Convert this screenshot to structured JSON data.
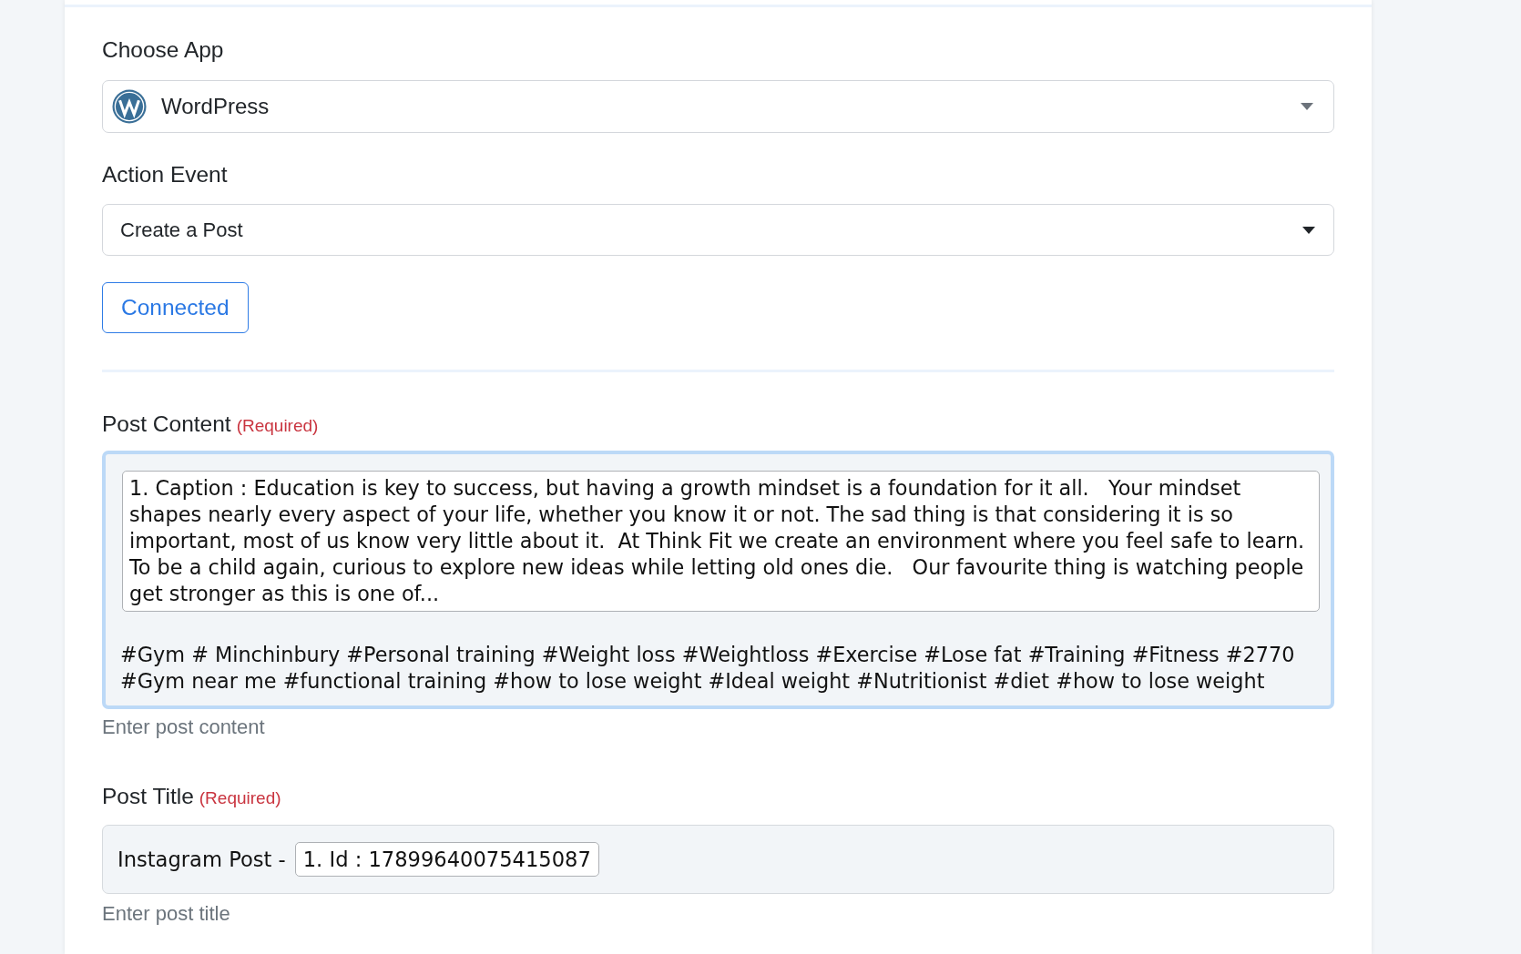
{
  "choose_app": {
    "label": "Choose App",
    "value": "WordPress"
  },
  "action_event": {
    "label": "Action Event",
    "value": "Create a Post"
  },
  "connection_button": {
    "label": "Connected"
  },
  "post_content": {
    "label": "Post Content",
    "required_note": "(Required)",
    "focused": true,
    "parts": [
      {
        "kind": "token",
        "text": "1. Caption : Education is key to success, but having a growth mindset is a foundation for it all.   Your mindset shapes nearly every aspect of your life, whether you know it or not. The sad thing is that considering it is so important, most of us know very little about it.  At Think Fit we create an environment where you feel safe to learn. To be a child again, curious to explore new ideas while letting old ones die.   Our favourite thing is watching people get stronger as this is one of..."
      },
      {
        "kind": "text",
        "text": "#Gym # Minchinbury #Personal training #Weight loss #Weightloss #Exercise #Lose fat #Training #Fitness #2770 #Gym near me #functional training #how to lose weight #Ideal weight #Nutritionist #diet #how to lose weight"
      }
    ],
    "hint": "Enter post content"
  },
  "post_title": {
    "label": "Post Title",
    "required_note": "(Required)",
    "focused": false,
    "parts": [
      {
        "kind": "text",
        "text": "Instagram Post -"
      },
      {
        "kind": "token",
        "text": "1. Id : 17899640075415087"
      }
    ],
    "hint": "Enter post title"
  }
}
